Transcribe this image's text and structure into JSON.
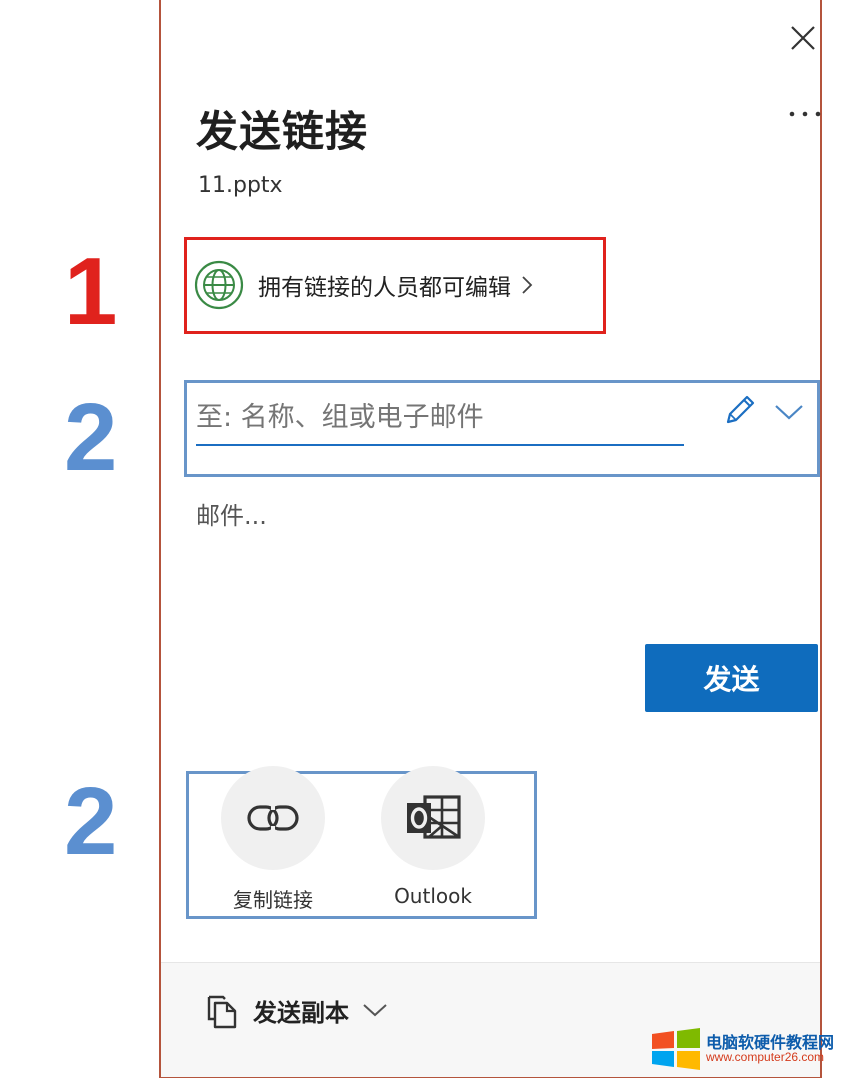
{
  "dialog": {
    "title": "发送链接",
    "filename": "11.pptx",
    "permission_label": "拥有链接的人员都可编辑",
    "to_placeholder": "至: 名称、组或电子邮件",
    "message_placeholder": "邮件...",
    "send_label": "发送",
    "share_options": [
      {
        "label": "复制链接",
        "icon": "link-icon"
      },
      {
        "label": "Outlook",
        "icon": "outlook-icon"
      }
    ],
    "send_copy_label": "发送副本",
    "icons": [
      "close-icon",
      "more-options-icon",
      "globe-icon",
      "chevron-right-icon",
      "pencil-icon",
      "chevron-down-icon",
      "copy-document-icon"
    ]
  },
  "annotations": {
    "marker_1": "1",
    "marker_2a": "2",
    "marker_2b": "2",
    "colors": {
      "red": "#e0221d",
      "blue": "#5b8fd0"
    }
  },
  "watermark": {
    "title": "电脑软硬件教程网",
    "url": "www.computer26.com"
  },
  "colors": {
    "accent": "#0f6cbd",
    "globe": "#3a8a45"
  }
}
